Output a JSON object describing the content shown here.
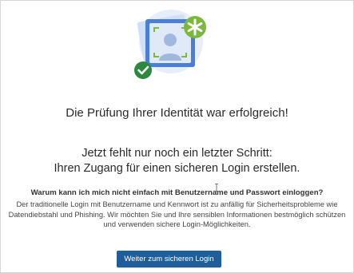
{
  "illustration": {
    "icons": [
      "face-scan-icon",
      "checkmark-icon",
      "asterisk-icon"
    ],
    "colors": {
      "frame_blue": "#4a7fd4",
      "light_blue": "#cfe0f7",
      "green": "#7cb83e",
      "dark_green": "#2b8a3e"
    }
  },
  "verification": {
    "success_message": "Die Prüfung Ihrer Identität war erfolgreich!"
  },
  "next_step": {
    "line1": "Jetzt fehlt nur noch ein letzter Schritt:",
    "line2": "Ihren Zugang für einen sicheren Login erstellen."
  },
  "info": {
    "question": "Warum kann ich mich nicht einfach mit Benutzername und Passwort einloggen?",
    "explanation": "Der traditionelle Login mit Benutzername und Kennwort ist zu anfällig für Sicherheitsprobleme wie Datendiebstahl und Phishing. Wir möchten Sie und Ihre sensiblen Informationen bestmöglich schützen und verwenden sichere Login-Möglichkeiten."
  },
  "actions": {
    "continue_label": "Weiter zum sicheren Login",
    "button_color": "#1e5f9b"
  }
}
